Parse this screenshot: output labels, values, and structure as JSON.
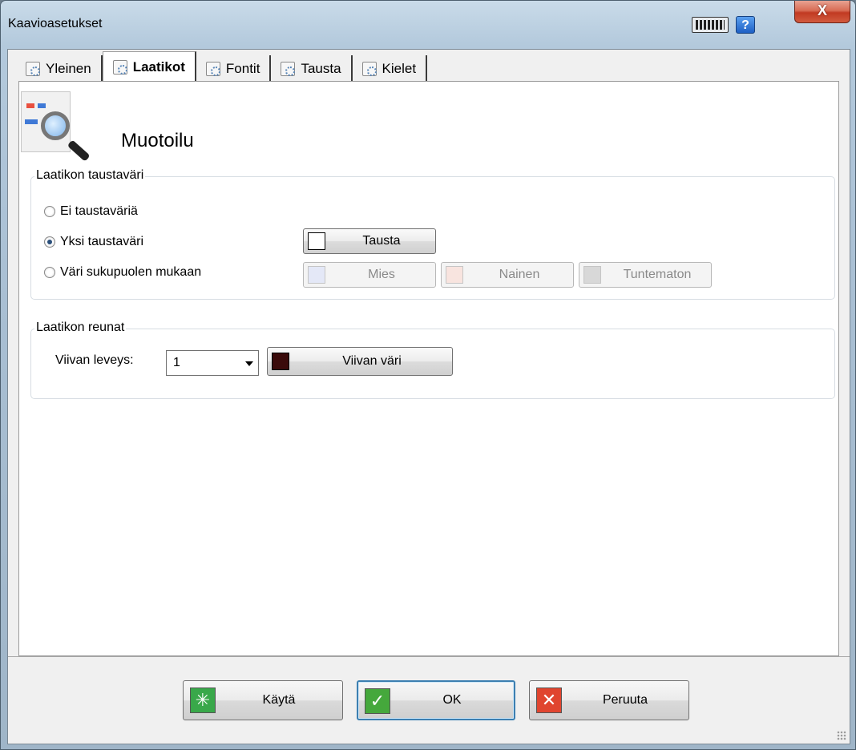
{
  "window": {
    "title": "Kaavioasetukset",
    "close_glyph": "X",
    "help_glyph": "?"
  },
  "tabs": [
    {
      "label": "Yleinen",
      "icon": "settings-icon"
    },
    {
      "label": "Laatikot",
      "icon": "settings-icon",
      "active": true
    },
    {
      "label": "Fontit",
      "icon": "settings-icon"
    },
    {
      "label": "Tausta",
      "icon": "settings-icon"
    },
    {
      "label": "Kielet",
      "icon": "settings-icon"
    }
  ],
  "header": {
    "title": "Muotoilu",
    "icon": "box-search-icon"
  },
  "background_group": {
    "legend": "Laatikon taustaväri",
    "options": [
      {
        "label": "Ei taustaväriä",
        "checked": false
      },
      {
        "label": "Yksi taustaväri",
        "checked": true
      },
      {
        "label": "Väri sukupuolen mukaan",
        "checked": false
      }
    ],
    "single_color_button": {
      "label": "Tausta",
      "color": "#ffffff"
    },
    "gender_buttons": [
      {
        "label": "Mies",
        "color": "#e4e8f7"
      },
      {
        "label": "Nainen",
        "color": "#f8e4df"
      },
      {
        "label": "Tuntematon",
        "color": "#d8d8d8"
      }
    ]
  },
  "border_group": {
    "legend": "Laatikon reunat",
    "line_width_label": "Viivan leveys:",
    "line_width_value": "1",
    "line_color_button": {
      "label": "Viivan väri",
      "color": "#3a0a0a"
    }
  },
  "footer": {
    "apply_label": "Käytä",
    "ok_label": "OK",
    "cancel_label": "Peruuta",
    "apply_glyph": "✳",
    "ok_glyph": "✓",
    "cancel_glyph": "✕"
  }
}
